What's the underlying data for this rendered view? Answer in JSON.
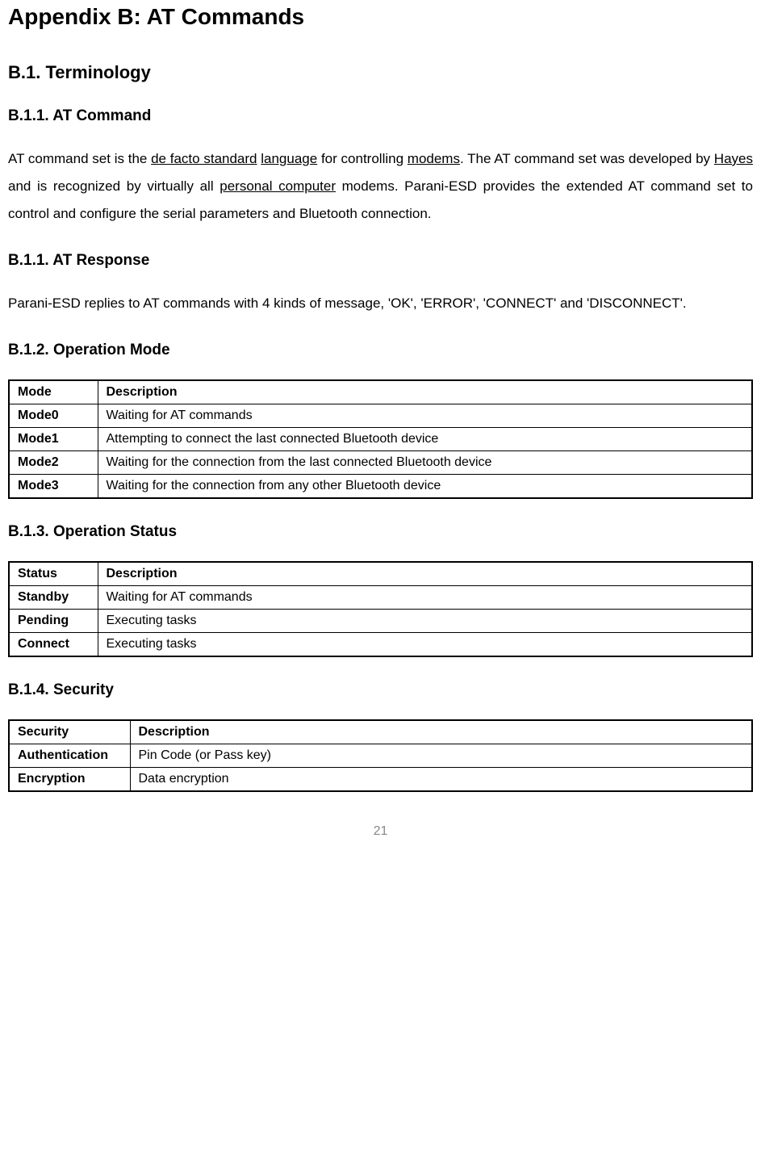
{
  "page_title": "Appendix B: AT Commands",
  "section_b1": "B.1. Terminology",
  "section_b11a": "B.1.1. AT Command",
  "para_b11a_part1": "AT command set is the ",
  "para_b11a_link1": "de facto standard",
  "para_b11a_space1": " ",
  "para_b11a_link2": "language",
  "para_b11a_part2": " for controlling ",
  "para_b11a_link3": "modems",
  "para_b11a_part3": ". The AT command set was developed by ",
  "para_b11a_link4": "Hayes",
  "para_b11a_part4": " and is recognized by virtually all ",
  "para_b11a_link5": "personal computer",
  "para_b11a_part5": " modems. Parani-ESD provides the extended AT command set to control and configure the serial parameters and Bluetooth connection.",
  "section_b11b": "B.1.1. AT Response",
  "para_b11b": "Parani-ESD replies to AT commands with 4 kinds of message, 'OK', 'ERROR', 'CONNECT' and 'DISCONNECT'.",
  "section_b12": "B.1.2. Operation Mode",
  "table_mode": {
    "headers": [
      "Mode",
      "Description"
    ],
    "rows": [
      {
        "label": "Mode0",
        "desc": "Waiting for AT commands"
      },
      {
        "label": "Mode1",
        "desc": "Attempting to connect the last connected Bluetooth device"
      },
      {
        "label": "Mode2",
        "desc": "Waiting for the connection from the last connected Bluetooth device"
      },
      {
        "label": "Mode3",
        "desc": "Waiting for the connection from any other Bluetooth device"
      }
    ]
  },
  "section_b13": "B.1.3. Operation Status",
  "table_status": {
    "headers": [
      "Status",
      "Description"
    ],
    "rows": [
      {
        "label": "Standby",
        "desc": "Waiting for AT commands"
      },
      {
        "label": "Pending",
        "desc": "Executing tasks"
      },
      {
        "label": "Connect",
        "desc": "Executing tasks"
      }
    ]
  },
  "section_b14": "B.1.4. Security",
  "table_security": {
    "headers": [
      "Security",
      "Description"
    ],
    "rows": [
      {
        "label": "Authentication",
        "desc": "Pin Code (or Pass key)"
      },
      {
        "label": "Encryption",
        "desc": "Data encryption"
      }
    ]
  },
  "page_number": "21"
}
